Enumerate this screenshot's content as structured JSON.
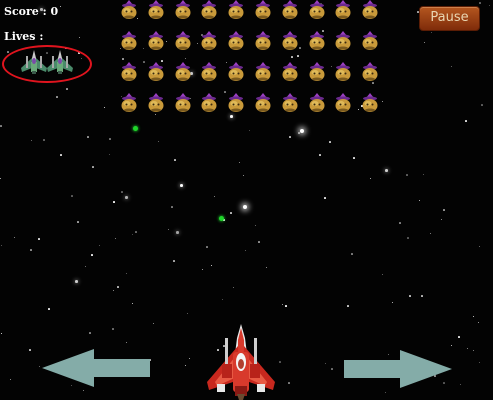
{
  "hud": {
    "score_text": "Score : 0",
    "lives_text": "Lives :",
    "lives_remaining": 2,
    "pause_label": "Pause"
  },
  "enemy_grid": {
    "rows": 4,
    "columns": 10
  },
  "icons": {
    "left_control": "left-arrow-icon",
    "right_control": "right-arrow-icon",
    "player": "red-fighter-jet",
    "life": "green-fighter-jet",
    "enemy": "purple-hatted-alien-pod"
  },
  "colors": {
    "background": "#030303",
    "pause_button": "#9c3f12",
    "pause_text": "#e9d6b2",
    "lives_highlight": "#e0141e",
    "arrow": "#84aca8",
    "bullet": "#1fd52a",
    "player_ship": "#d83a2c"
  }
}
